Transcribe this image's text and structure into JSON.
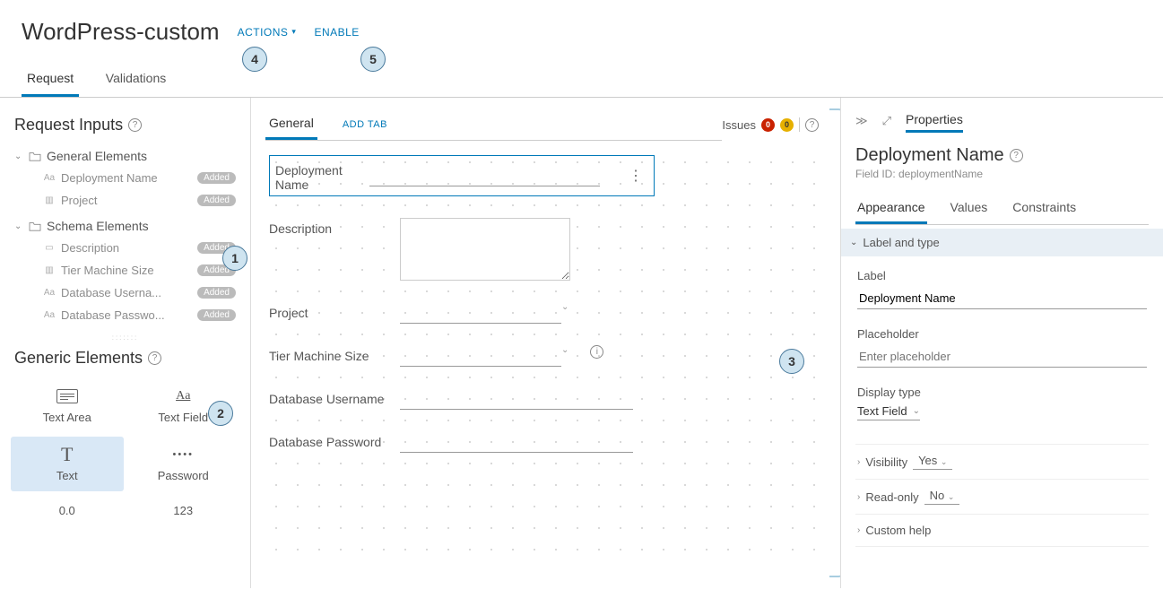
{
  "header": {
    "title": "WordPress-custom",
    "actions_label": "ACTIONS",
    "enable_label": "ENABLE"
  },
  "topTabs": {
    "items": [
      {
        "label": "Request",
        "active": true
      },
      {
        "label": "Validations",
        "active": false
      }
    ]
  },
  "sidebar": {
    "requestInputsTitle": "Request Inputs",
    "groups": [
      {
        "label": "General Elements",
        "items": [
          {
            "icon": "Aa",
            "label": "Deployment Name",
            "added": "Added"
          },
          {
            "icon": "▥",
            "label": "Project",
            "added": "Added"
          }
        ]
      },
      {
        "label": "Schema Elements",
        "items": [
          {
            "icon": "▭",
            "label": "Description",
            "added": "Added"
          },
          {
            "icon": "▥",
            "label": "Tier Machine Size",
            "added": "Added"
          },
          {
            "icon": "Aa",
            "label": "Database Userna...",
            "added": "Added"
          },
          {
            "icon": "Aa",
            "label": "Database Passwo...",
            "added": "Added"
          }
        ]
      }
    ],
    "genericTitle": "Generic Elements",
    "generic": [
      {
        "label": "Text Area",
        "type": "ta"
      },
      {
        "label": "Text Field",
        "type": "tf"
      },
      {
        "label": "Text",
        "type": "tx",
        "selected": true
      },
      {
        "label": "Password",
        "type": "pw"
      },
      {
        "label": "0.0",
        "type": "num"
      },
      {
        "label": "123",
        "type": "int"
      }
    ]
  },
  "canvas": {
    "issuesLabel": "Issues",
    "errCount": "0",
    "warnCount": "0",
    "tabs": {
      "main": "General",
      "add": "ADD TAB"
    },
    "fields": [
      {
        "label": "Deployment Name",
        "type": "text",
        "selected": true
      },
      {
        "label": "Description",
        "type": "textarea"
      },
      {
        "label": "Project",
        "type": "select"
      },
      {
        "label": "Tier Machine Size",
        "type": "select",
        "info": true
      },
      {
        "label": "Database Username",
        "type": "text"
      },
      {
        "label": "Database Password",
        "type": "text"
      }
    ]
  },
  "properties": {
    "panelTitle": "Properties",
    "heading": "Deployment Name",
    "fieldIdLabel": "Field ID: deploymentName",
    "tabs": [
      {
        "label": "Appearance",
        "active": true
      },
      {
        "label": "Values",
        "active": false
      },
      {
        "label": "Constraints",
        "active": false
      }
    ],
    "labelAndType": "Label and type",
    "labelLabel": "Label",
    "labelValue": "Deployment Name",
    "placeholderLabel": "Placeholder",
    "placeholderPlaceholder": "Enter placeholder",
    "displayTypeLabel": "Display type",
    "displayTypeValue": "Text Field",
    "visibilityLabel": "Visibility",
    "visibilityValue": "Yes",
    "readonlyLabel": "Read-only",
    "readonlyValue": "No",
    "customHelpLabel": "Custom help"
  },
  "callouts": {
    "c1": "1",
    "c2": "2",
    "c3": "3",
    "c4": "4",
    "c5": "5"
  }
}
